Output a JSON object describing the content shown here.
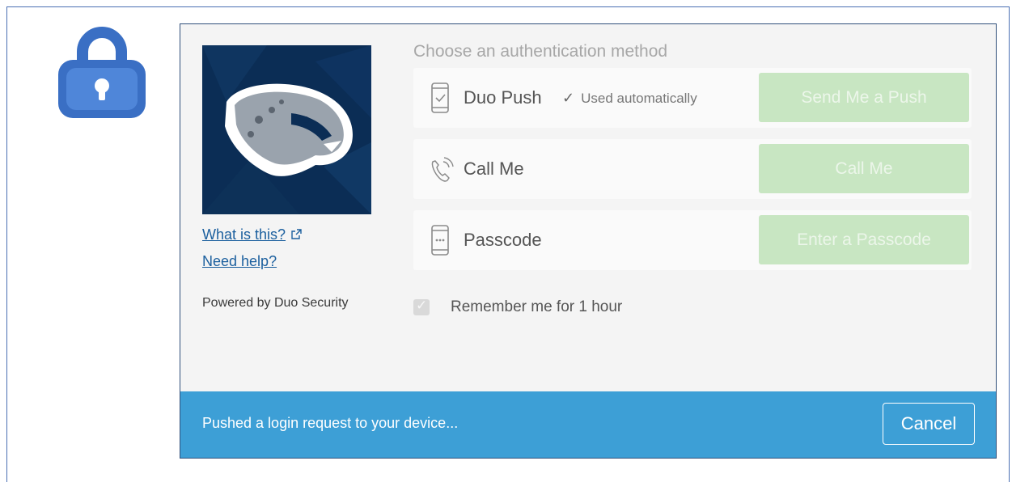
{
  "colors": {
    "accent_blue": "#3d9fd6",
    "button_green": "#c8e6c2",
    "link_blue": "#1b5f9e",
    "logo_navy": "#0b2d55"
  },
  "icons": {
    "lock": "lock-icon",
    "push": "phone-check-icon",
    "call": "phone-call-icon",
    "passcode": "passcode-device-icon",
    "external": "external-link-icon",
    "check": "checkmark-icon"
  },
  "sidebar": {
    "what_is_this": "What is this?",
    "need_help": "Need help?",
    "powered_by": "Powered by Duo Security"
  },
  "main": {
    "heading": "Choose an authentication method",
    "methods": [
      {
        "label": "Duo Push",
        "note": "Used automatically",
        "button": "Send Me a Push"
      },
      {
        "label": "Call Me",
        "button": "Call Me"
      },
      {
        "label": "Passcode",
        "button": "Enter a Passcode"
      }
    ],
    "remember": {
      "label": "Remember me for 1 hour",
      "checked": true
    }
  },
  "status": {
    "message": "Pushed a login request to your device...",
    "cancel_label": "Cancel"
  }
}
